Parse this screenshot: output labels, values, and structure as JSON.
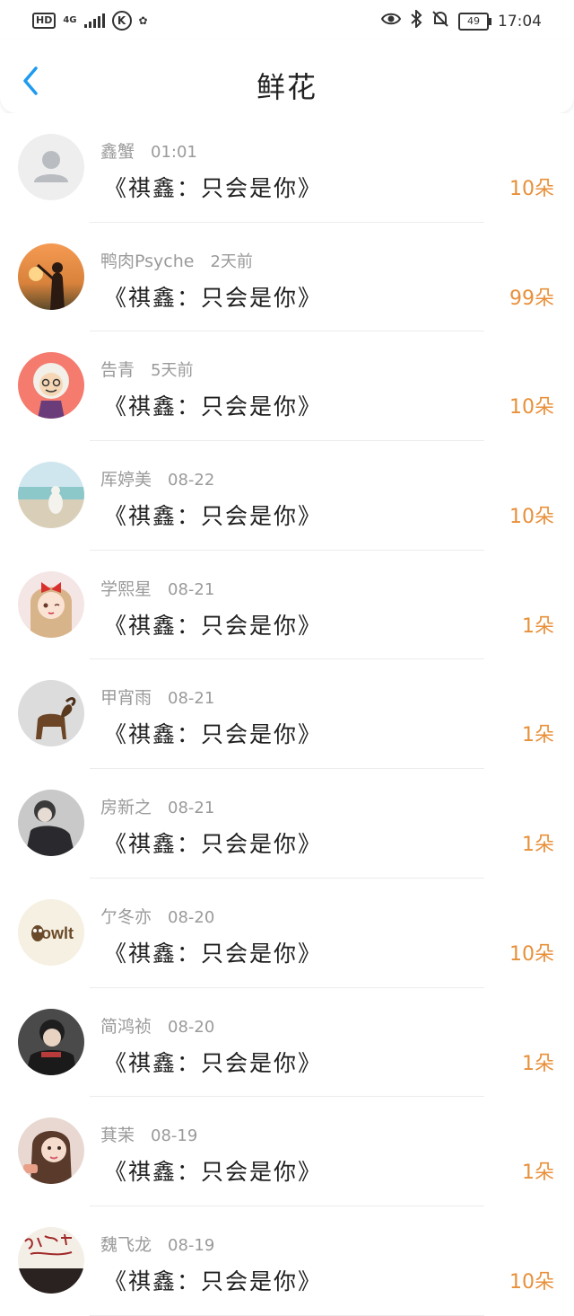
{
  "status_bar": {
    "left": {
      "hd": "HD",
      "network": "4G",
      "k_icon": "K"
    },
    "right": {
      "battery": "49",
      "time": "17:04"
    }
  },
  "header": {
    "title": "鲜花"
  },
  "items": [
    {
      "name": "鑫蟹",
      "time": "01:01",
      "gift": "《祺鑫：只会是你》",
      "amount": "10朵",
      "avatar": "default"
    },
    {
      "name": "鸭肉Psyche",
      "time": "2天前",
      "gift": "《祺鑫：只会是你》",
      "amount": "99朵",
      "avatar": "sunset-girl"
    },
    {
      "name": "告青",
      "time": "5天前",
      "gift": "《祺鑫：只会是你》",
      "amount": "10朵",
      "avatar": "grandma"
    },
    {
      "name": "厍婷美",
      "time": "08-22",
      "gift": "《祺鑫：只会是你》",
      "amount": "10朵",
      "avatar": "beach"
    },
    {
      "name": "学熙星",
      "time": "08-21",
      "gift": "《祺鑫：只会是你》",
      "amount": "1朵",
      "avatar": "anime-girl"
    },
    {
      "name": "甲宵雨",
      "time": "08-21",
      "gift": "《祺鑫：只会是你》",
      "amount": "1朵",
      "avatar": "goat-statue"
    },
    {
      "name": "房新之",
      "time": "08-21",
      "gift": "《祺鑫：只会是你》",
      "amount": "1朵",
      "avatar": "man-grey"
    },
    {
      "name": "亇冬亦",
      "time": "08-20",
      "gift": "《祺鑫：只会是你》",
      "amount": "10朵",
      "avatar": "owlt-logo"
    },
    {
      "name": "简鸿祯",
      "time": "08-20",
      "gift": "《祺鑫：只会是你》",
      "amount": "1朵",
      "avatar": "man-dark"
    },
    {
      "name": "萁茉",
      "time": "08-19",
      "gift": "《祺鑫：只会是你》",
      "amount": "1朵",
      "avatar": "woman-portrait"
    },
    {
      "name": "魏飞龙",
      "time": "08-19",
      "gift": "《祺鑫：只会是你》",
      "amount": "10朵",
      "avatar": "calligraphy"
    }
  ],
  "colors": {
    "accent": "#1e9bf0",
    "amount": "#e8903a",
    "meta": "#9a9a9a"
  }
}
